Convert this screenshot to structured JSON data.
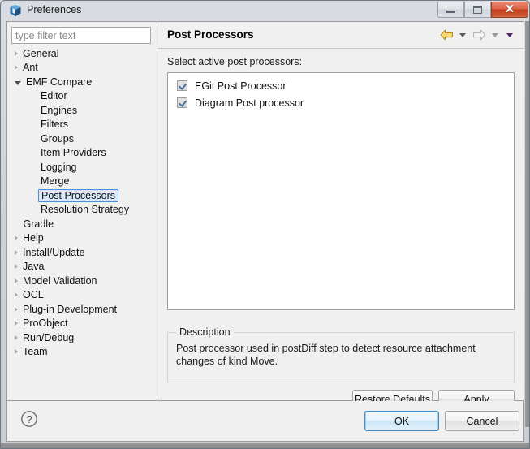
{
  "window": {
    "title": "Preferences",
    "icon": "eclipse-cube-icon",
    "controls": {
      "minimize": "minimize-icon",
      "maximize": "maximize-icon",
      "close": "✕"
    }
  },
  "sidebar": {
    "filter": {
      "placeholder": "type filter text",
      "value": ""
    },
    "items": [
      {
        "label": "General",
        "indent": 0,
        "state": "collapsed",
        "selected": false
      },
      {
        "label": "Ant",
        "indent": 0,
        "state": "collapsed",
        "selected": false
      },
      {
        "label": "EMF Compare",
        "indent": 0,
        "state": "expanded",
        "selected": false
      },
      {
        "label": "Editor",
        "indent": 1,
        "state": "leaf",
        "selected": false
      },
      {
        "label": "Engines",
        "indent": 1,
        "state": "leaf",
        "selected": false
      },
      {
        "label": "Filters",
        "indent": 1,
        "state": "leaf",
        "selected": false
      },
      {
        "label": "Groups",
        "indent": 1,
        "state": "leaf",
        "selected": false
      },
      {
        "label": "Item Providers",
        "indent": 1,
        "state": "leaf",
        "selected": false
      },
      {
        "label": "Logging",
        "indent": 1,
        "state": "leaf",
        "selected": false
      },
      {
        "label": "Merge",
        "indent": 1,
        "state": "leaf",
        "selected": false
      },
      {
        "label": "Post Processors",
        "indent": 1,
        "state": "leaf",
        "selected": true
      },
      {
        "label": "Resolution Strategy",
        "indent": 1,
        "state": "leaf",
        "selected": false
      },
      {
        "label": "Gradle",
        "indent": 0,
        "state": "leaf",
        "selected": false
      },
      {
        "label": "Help",
        "indent": 0,
        "state": "collapsed",
        "selected": false
      },
      {
        "label": "Install/Update",
        "indent": 0,
        "state": "collapsed",
        "selected": false
      },
      {
        "label": "Java",
        "indent": 0,
        "state": "collapsed",
        "selected": false
      },
      {
        "label": "Model Validation",
        "indent": 0,
        "state": "collapsed",
        "selected": false
      },
      {
        "label": "OCL",
        "indent": 0,
        "state": "collapsed",
        "selected": false
      },
      {
        "label": "Plug-in Development",
        "indent": 0,
        "state": "collapsed",
        "selected": false
      },
      {
        "label": "ProObject",
        "indent": 0,
        "state": "collapsed",
        "selected": false
      },
      {
        "label": "Run/Debug",
        "indent": 0,
        "state": "collapsed",
        "selected": false
      },
      {
        "label": "Team",
        "indent": 0,
        "state": "collapsed",
        "selected": false
      }
    ]
  },
  "page": {
    "title": "Post Processors",
    "nav": {
      "back_icon": "back-arrow-icon",
      "back_menu_icon": "chevron-down-icon",
      "forward_icon": "forward-arrow-icon",
      "forward_menu_icon": "chevron-down-icon",
      "view_menu_icon": "chevron-down-icon",
      "back_color": "#d9a226",
      "forward_color": "#b8b8b8",
      "view_menu_color": "#56256e"
    },
    "select_label": "Select active post processors:",
    "processors": [
      {
        "label": "EGit Post Processor",
        "checked": true
      },
      {
        "label": "Diagram Post processor",
        "checked": true
      }
    ],
    "description": {
      "legend": "Description",
      "text": "Post processor used in postDiff step to detect resource attachment changes of kind Move."
    },
    "buttons": {
      "restore_defaults": "Restore Defaults",
      "apply": "Apply"
    }
  },
  "footer": {
    "help_icon": "question-mark-icon",
    "ok": "OK",
    "cancel": "Cancel"
  }
}
